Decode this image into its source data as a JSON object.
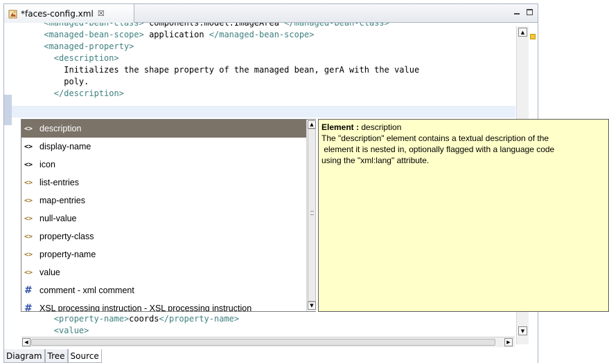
{
  "editor": {
    "tab_title": "*faces-config.xml",
    "tab_close": "☒"
  },
  "code": {
    "lines": [
      {
        "indent": "      ",
        "parts": [
          {
            "t": "tag",
            "v": "<managed-bean-class>"
          },
          {
            "t": "txt",
            "v": " components.model.ImageArea "
          },
          {
            "t": "tag",
            "v": "</managed-bean-class>"
          }
        ]
      },
      {
        "indent": "      ",
        "parts": [
          {
            "t": "tag",
            "v": "<managed-bean-scope>"
          },
          {
            "t": "txt",
            "v": " application "
          },
          {
            "t": "tag",
            "v": "</managed-bean-scope>"
          }
        ]
      },
      {
        "indent": "      ",
        "parts": [
          {
            "t": "tag",
            "v": "<managed-property>"
          }
        ]
      },
      {
        "indent": "        ",
        "parts": [
          {
            "t": "tag",
            "v": "<description>"
          }
        ]
      },
      {
        "indent": "          ",
        "parts": [
          {
            "t": "txt",
            "v": "Initializes the shape property of the managed bean, gerA with the value"
          }
        ]
      },
      {
        "indent": "          ",
        "parts": [
          {
            "t": "txt",
            "v": "poly."
          }
        ]
      },
      {
        "indent": "        ",
        "parts": [
          {
            "t": "tag",
            "v": "</description>"
          }
        ]
      },
      {
        "indent": "",
        "parts": []
      }
    ],
    "lower_lines": [
      {
        "indent": "        ",
        "parts": [
          {
            "t": "tag",
            "v": "<property-name>"
          },
          {
            "t": "txt",
            "v": "coords"
          },
          {
            "t": "tag",
            "v": "</property-name>"
          }
        ]
      },
      {
        "indent": "        ",
        "parts": [
          {
            "t": "tag",
            "v": "<value>"
          }
        ]
      }
    ]
  },
  "assist": {
    "items": [
      {
        "icon": "<>",
        "icon_name": "element-icon",
        "style": "normal",
        "label": "description",
        "selected": true
      },
      {
        "icon": "<>",
        "icon_name": "element-icon",
        "style": "dark",
        "label": "display-name",
        "selected": false
      },
      {
        "icon": "<>",
        "icon_name": "element-icon",
        "style": "dark",
        "label": "icon",
        "selected": false
      },
      {
        "icon": "<>",
        "icon_name": "element-icon",
        "style": "normal",
        "label": "list-entries",
        "selected": false
      },
      {
        "icon": "<>",
        "icon_name": "element-icon",
        "style": "normal",
        "label": "map-entries",
        "selected": false
      },
      {
        "icon": "<>",
        "icon_name": "element-icon",
        "style": "normal",
        "label": "null-value",
        "selected": false
      },
      {
        "icon": "<>",
        "icon_name": "element-icon",
        "style": "normal",
        "label": "property-class",
        "selected": false
      },
      {
        "icon": "<>",
        "icon_name": "element-icon",
        "style": "normal",
        "label": "property-name",
        "selected": false
      },
      {
        "icon": "<>",
        "icon_name": "element-icon",
        "style": "normal",
        "label": "value",
        "selected": false
      },
      {
        "icon": "#",
        "icon_name": "hash-icon",
        "style": "hash",
        "label": "comment - xml comment",
        "selected": false
      },
      {
        "icon": "#",
        "icon_name": "hash-icon",
        "style": "hash",
        "label": "XSL processing instruction - XSL processing instruction",
        "selected": false
      }
    ]
  },
  "info": {
    "title_label": "Element :",
    "title_value": "description",
    "lines": [
      "The \"description\" element contains a textual description of the",
      " element it is nested in, optionally flagged with a language code",
      "using the \"xml:lang\" attribute."
    ]
  },
  "bottom_tabs": [
    "Diagram",
    "Tree",
    "Source"
  ],
  "active_bottom_tab": "Source",
  "colors": {
    "tag": "#3f7f7f",
    "selection": "#7b7268",
    "info_bg": "#ffffc9",
    "current_line": "#e8f0fb"
  }
}
